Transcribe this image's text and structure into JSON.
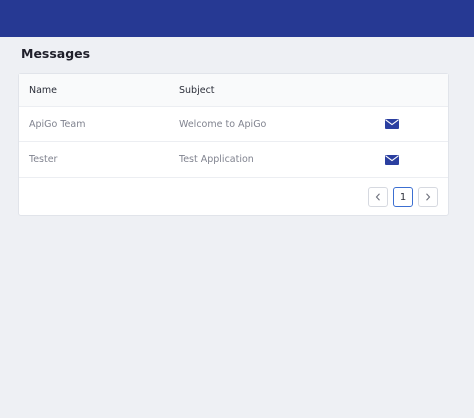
{
  "page": {
    "title": "Messages"
  },
  "table": {
    "headers": {
      "name": "Name",
      "subject": "Subject"
    },
    "rows": [
      {
        "name": "ApiGo Team",
        "subject": "Welcome to ApiGo",
        "icon": "envelope-icon"
      },
      {
        "name": "Tester",
        "subject": "Test Application",
        "icon": "envelope-icon"
      }
    ]
  },
  "pagination": {
    "current_page": "1",
    "prev_icon": "chevron-left-icon",
    "next_icon": "chevron-right-icon"
  },
  "colors": {
    "topbar": "#263993",
    "accent": "#2b3fa0",
    "background": "#eef0f4"
  }
}
